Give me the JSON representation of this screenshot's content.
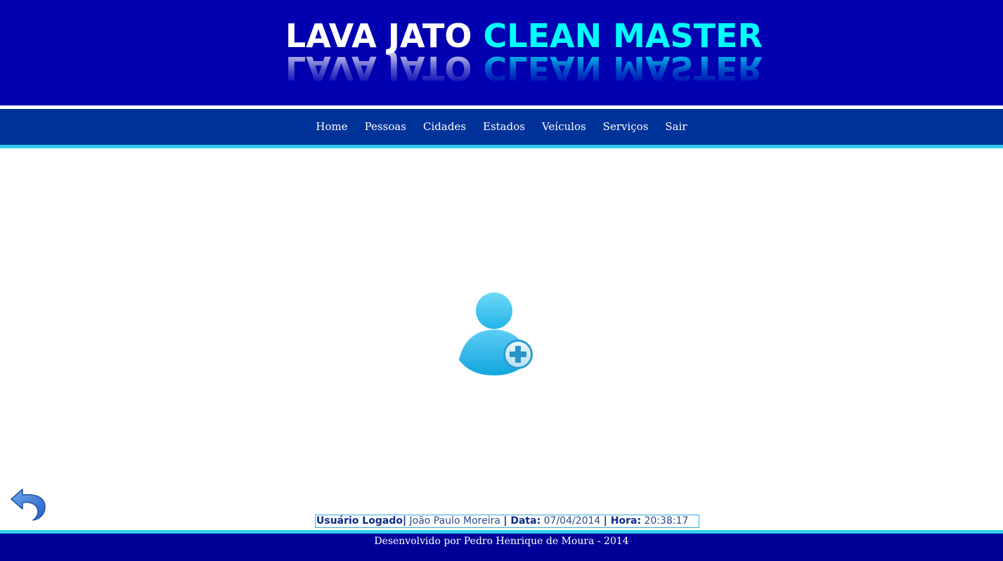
{
  "header": {
    "logo_word1": "LAVA JATO",
    "logo_word2": "CLEAN MASTER"
  },
  "nav": {
    "items": [
      {
        "label": "Home"
      },
      {
        "label": "Pessoas"
      },
      {
        "label": "Cidades"
      },
      {
        "label": "Estados"
      },
      {
        "label": "Veículos"
      },
      {
        "label": "Serviços"
      },
      {
        "label": "Sair"
      }
    ]
  },
  "main": {
    "center_icon": "user-add-icon",
    "back_icon": "undo-arrow-icon"
  },
  "status": {
    "user_label": "Usuário Logado|",
    "user_value": "João Paulo Moreira",
    "date_label": "| Data:",
    "date_value": "07/04/2014",
    "time_label": "| Hora:",
    "time_value": "20:38:17"
  },
  "footer": {
    "text": "Desenvolvido por Pedro Henrique de Moura - 2014"
  },
  "colors": {
    "header_bg": "#0000b0",
    "nav_bg": "#003399",
    "accent": "#33ccee",
    "footer_bg": "#000099",
    "logo_cyan": "#00ffff"
  }
}
